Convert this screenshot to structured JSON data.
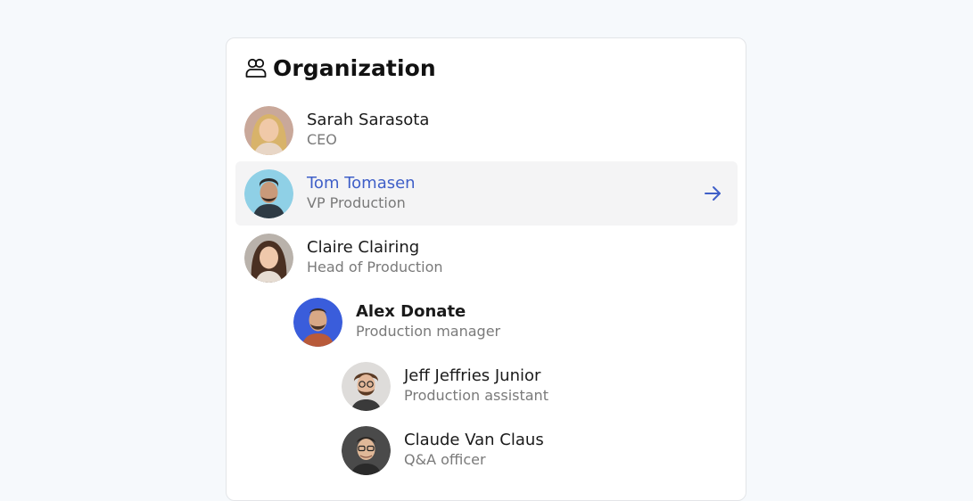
{
  "header": {
    "title": "Organization",
    "icon": "users-icon"
  },
  "people": [
    {
      "name": "Sarah Sarasota",
      "role": "CEO",
      "level": 0,
      "selected": false,
      "bold": false
    },
    {
      "name": "Tom Tomasen",
      "role": "VP Production",
      "level": 0,
      "selected": true,
      "bold": false
    },
    {
      "name": "Claire Clairing",
      "role": "Head of Production",
      "level": 0,
      "selected": false,
      "bold": false
    },
    {
      "name": "Alex Donate",
      "role": "Production manager",
      "level": 1,
      "selected": false,
      "bold": true
    },
    {
      "name": "Jeff Jeffries Junior",
      "role": "Production assistant",
      "level": 2,
      "selected": false,
      "bold": false
    },
    {
      "name": "Claude Van Claus",
      "role": "Q&A officer",
      "level": 2,
      "selected": false,
      "bold": false
    }
  ],
  "colors": {
    "accent": "#3f5fc8",
    "selected_bg": "#f4f4f5",
    "page_bg": "#f6f9fc"
  }
}
